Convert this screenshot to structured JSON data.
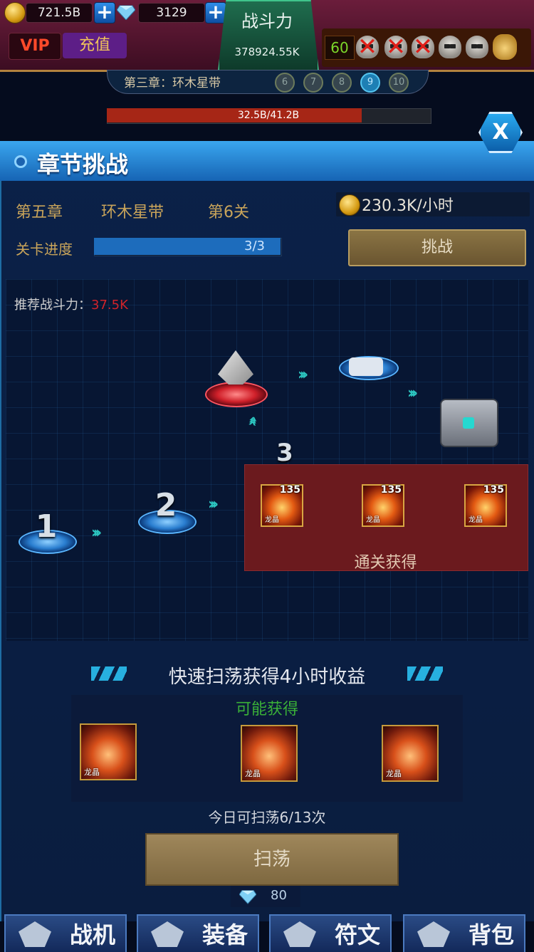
{
  "resources": {
    "gold": "721.5B",
    "diamonds": "3129"
  },
  "vip": {
    "label": "VIP",
    "recharge_label": "充值"
  },
  "power": {
    "label": "战斗力",
    "value": "378924.55K"
  },
  "level": "60",
  "chapter_strip": {
    "text": "第三章：环木星带",
    "dots": [
      "6",
      "7",
      "8",
      "9",
      "10"
    ],
    "active_dot": "9"
  },
  "hp": {
    "text": "32.5B/41.2B",
    "fraction": 0.789
  },
  "dialog": {
    "title": "章节挑战",
    "close_label": "X",
    "chapter": "第五章",
    "area": "环木星带",
    "stage": "第6关",
    "rate": "230.3K/小时",
    "progress_label": "关卡进度",
    "progress_text": "3/3",
    "progress_fraction": 1.0,
    "challenge_label": "挑战"
  },
  "map": {
    "recommend_label": "推荐战斗力：",
    "recommend_value": "37.5K",
    "nodes": [
      "1",
      "2",
      "3"
    ]
  },
  "clear_reward": {
    "title": "通关获得",
    "items": [
      {
        "name": "龙晶",
        "count": "135"
      },
      {
        "name": "龙晶",
        "count": "135"
      },
      {
        "name": "龙晶",
        "count": "135"
      }
    ]
  },
  "sweep": {
    "title": "快速扫荡获得4小时收益",
    "can_get_label": "可能获得",
    "items": [
      {
        "name": "龙晶"
      },
      {
        "name": "龙晶"
      },
      {
        "name": "龙晶"
      }
    ],
    "count_text": "今日可扫荡6/13次",
    "button_label": "扫荡",
    "cost": "80"
  },
  "bottom_nav": [
    "战机",
    "装备",
    "符文",
    "背包"
  ],
  "colors": {
    "accent": "#1d6cbc",
    "danger": "#d0232a",
    "gold": "#c9a45a"
  }
}
